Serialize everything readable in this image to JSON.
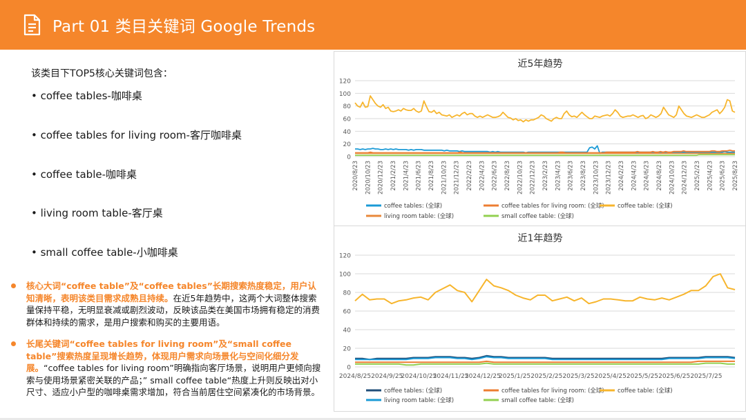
{
  "header": {
    "title": "Part 01 类目关键词 Google Trends",
    "icon": "document-icon",
    "bg_color": "#f5862b"
  },
  "left": {
    "intro": "该类目下TOP5核心关键词包含：",
    "keywords": [
      "• coffee tables-咖啡桌",
      "• coffee tables for living room-客厅咖啡桌",
      "• coffee table-咖啡桌",
      "• living room table-客厅桌",
      "• small coffee table-小咖啡桌"
    ],
    "notes": [
      {
        "highlight": "核心大词“coffee table”及“coffee tables”长期搜索热度稳定，用户认知清晰，表明该类目需求成熟且持续。",
        "body": "在近5年趋势中，这两个大词整体搜索量保持平稳，无明显衰减或剧烈波动，反映该品类在美国市场拥有稳定的消费群体和持续的需求，是用户搜索和购买的主要用语。"
      },
      {
        "highlight": "长尾关键词“coffee tables for living room”及“small coffee table”搜索热度呈现增长趋势，体现用户需求向场景化与空间化细分发展。",
        "body": "“coffee tables for living room”明确指向客厅场景，说明用户更倾向搜索与使用场景紧密关联的产品；” small coffee table“热度上升则反映出对小尺寸、适应小户型的咖啡桌需求增加，符合当前居住空间紧凑化的市场背景。"
      }
    ],
    "accent_color": "#f5862b"
  },
  "chart_data": [
    {
      "type": "line",
      "title": "近5年趋势",
      "ylim": [
        0,
        120
      ],
      "yticks": [
        0,
        20,
        40,
        60,
        80,
        100,
        120
      ],
      "grid": true,
      "legend_position": "bottom",
      "x_labels": [
        "2020/8/23",
        "2020/10/23",
        "2020/12/23",
        "2021/2/23",
        "2021/4/23",
        "2021/6/23",
        "2021/8/23",
        "2021/10/23",
        "2021/12/23",
        "2022/2/23",
        "2022/4/23",
        "2022/6/23",
        "2022/8/23",
        "2022/10/23",
        "2022/12/23",
        "2023/2/23",
        "2023/4/23",
        "2023/6/23",
        "2023/8/23",
        "2023/10/23",
        "2023/12/23",
        "2024/2/23",
        "2024/4/23",
        "2024/6/23",
        "2024/8/23",
        "2024/10/23",
        "2024/12/23",
        "2025/2/23",
        "2025/4/23",
        "2025/6/23",
        "2025/8/23"
      ],
      "legend_order": [
        "coffee tables: (全球)",
        "coffee tables for living room: (全球)",
        "coffee table: (全球)",
        "living room table: (全球)",
        "small coffee table: (全球)"
      ],
      "series": [
        {
          "name": "coffee table: (全球)",
          "color": "#f7b52c",
          "values": [
            85,
            80,
            78,
            86,
            78,
            79,
            96,
            90,
            84,
            80,
            78,
            82,
            76,
            78,
            72,
            71,
            72,
            74,
            72,
            76,
            74,
            73,
            73,
            76,
            72,
            70,
            72,
            88,
            79,
            71,
            70,
            73,
            68,
            70,
            66,
            65,
            64,
            66,
            62,
            64,
            66,
            64,
            68,
            70,
            66,
            68,
            68,
            64,
            62,
            64,
            62,
            64,
            66,
            64,
            62,
            62,
            63,
            65,
            70,
            66,
            62,
            61,
            58,
            60,
            57,
            58,
            55,
            58,
            56,
            58,
            58,
            60,
            62,
            66,
            64,
            60,
            58,
            56,
            60,
            62,
            60,
            60,
            68,
            72,
            66,
            63,
            64,
            62,
            66,
            70,
            66,
            63,
            60,
            60,
            64,
            63,
            62,
            64,
            65,
            66,
            64,
            68,
            74,
            70,
            64,
            62,
            63,
            64,
            64,
            66,
            64,
            62,
            64,
            65,
            60,
            62,
            66,
            64,
            62,
            64,
            68,
            78,
            72,
            66,
            64,
            62,
            66,
            80,
            74,
            68,
            64,
            63,
            62,
            64,
            66,
            64,
            62,
            62,
            64,
            66,
            70,
            72,
            74,
            68,
            72,
            78,
            90,
            88,
            72,
            70
          ]
        },
        {
          "name": "coffee tables: (全球)",
          "color": "#1a9ad6",
          "values": [
            12,
            12,
            11,
            12,
            11,
            12,
            12,
            13,
            12,
            12,
            11,
            11,
            12,
            11,
            12,
            11,
            12,
            11,
            11,
            11,
            11,
            10,
            11,
            10,
            11,
            11,
            11,
            10,
            10,
            10,
            10,
            10,
            10,
            10,
            10,
            9,
            10,
            9,
            9,
            9,
            9,
            8,
            9,
            8,
            8,
            8,
            8,
            8,
            8,
            8,
            8,
            8,
            8,
            7,
            8,
            7,
            8,
            7,
            7,
            7,
            7,
            7,
            7,
            7,
            7,
            7,
            7,
            6,
            7,
            7,
            7,
            7,
            7,
            7,
            7,
            7,
            7,
            7,
            7,
            7,
            7,
            7,
            7,
            7,
            7,
            7,
            7,
            7,
            7,
            7,
            7,
            7,
            14,
            15,
            12,
            17,
            5,
            7,
            7,
            7,
            7,
            7,
            7,
            7,
            7,
            7,
            7,
            7,
            7,
            7,
            7,
            7,
            7,
            7,
            7,
            7,
            7,
            7,
            7,
            7,
            7,
            7,
            7,
            7,
            7,
            7,
            7,
            7,
            7,
            7,
            7,
            7,
            7,
            7,
            7,
            7,
            7,
            7,
            7,
            7,
            7,
            7,
            7,
            7,
            7,
            8,
            7,
            7,
            7,
            7
          ]
        },
        {
          "name": "coffee tables for living room: (全球)",
          "color": "#ed7d31",
          "values": [
            6,
            6,
            6,
            6,
            6,
            6,
            7,
            6,
            6,
            6,
            6,
            6,
            6,
            6,
            6,
            6,
            6,
            6,
            6,
            6,
            6,
            6,
            6,
            6,
            6,
            6,
            6,
            6,
            6,
            6,
            6,
            6,
            6,
            6,
            6,
            6,
            6,
            6,
            6,
            6,
            6,
            7,
            6,
            6,
            6,
            6,
            6,
            6,
            6,
            6,
            6,
            6,
            6,
            6,
            6,
            6,
            6,
            6,
            6,
            6,
            6,
            6,
            6,
            6,
            6,
            6,
            6,
            6,
            6,
            6,
            6,
            6,
            6,
            6,
            6,
            6,
            6,
            6,
            6,
            6,
            7,
            7,
            6,
            6,
            6,
            6,
            6,
            6,
            6,
            6,
            6,
            6,
            6,
            6,
            6,
            6,
            6,
            6,
            7,
            7,
            7,
            7,
            7,
            7,
            7,
            7,
            7,
            7,
            7,
            7,
            8,
            7,
            7,
            7,
            7,
            7,
            8,
            7,
            7,
            8,
            7,
            8,
            7,
            7,
            8,
            8,
            8,
            8,
            9,
            8,
            8,
            8,
            8,
            8,
            8,
            8,
            8,
            8,
            8,
            9,
            9,
            8,
            8,
            9,
            9,
            9,
            10,
            9,
            9
          ]
        },
        {
          "name": "living room table: (全球)",
          "color": "#e8883a",
          "values": [
            5,
            5,
            5,
            5,
            5,
            5,
            5,
            5,
            5,
            5,
            5,
            5,
            5,
            5,
            5,
            5,
            5,
            5,
            5,
            5,
            5,
            5,
            5,
            5,
            5,
            5,
            5,
            5,
            5,
            5,
            5,
            5,
            5,
            5,
            5,
            5,
            5,
            5,
            5,
            5,
            5,
            5,
            5,
            5,
            5,
            5,
            5,
            5,
            5,
            5,
            5,
            5,
            5,
            5,
            5,
            5,
            5,
            5,
            5,
            5,
            5,
            5,
            5,
            5,
            5,
            5,
            5,
            5,
            5,
            5,
            5,
            5,
            5,
            5,
            5,
            5,
            5,
            5,
            5,
            5,
            5,
            5,
            5,
            5,
            5,
            5,
            5,
            5,
            5,
            5,
            5,
            5,
            5,
            5,
            5,
            5,
            5,
            5,
            5,
            5,
            5,
            5,
            5,
            5,
            5,
            5,
            5,
            5,
            5,
            5,
            5,
            5,
            5,
            5,
            5,
            5,
            5,
            5,
            5,
            5,
            5,
            5,
            5,
            5,
            5,
            5,
            5,
            5,
            5,
            5,
            5,
            5,
            5,
            5,
            5,
            5,
            5,
            5,
            5,
            5,
            5,
            5,
            5,
            5,
            5,
            5,
            5,
            5,
            5
          ]
        },
        {
          "name": "small coffee table: (全球)",
          "color": "#92d050",
          "values": [
            2,
            2,
            2,
            2,
            2,
            2,
            2,
            2,
            2,
            2,
            2,
            2,
            2,
            2,
            2,
            2,
            2,
            2,
            2,
            2,
            2,
            2,
            2,
            2,
            2,
            2,
            2,
            2,
            2,
            2,
            2,
            2,
            2,
            2,
            2,
            2,
            2,
            2,
            2,
            2,
            2,
            2,
            2,
            2,
            2,
            2,
            2,
            2,
            2,
            2,
            2,
            2,
            2,
            2,
            2,
            2,
            2,
            2,
            2,
            2,
            2,
            2,
            2,
            2,
            2,
            2,
            2,
            2,
            2,
            2,
            2,
            2,
            2,
            2,
            2,
            2,
            2,
            2,
            2,
            2,
            2,
            2,
            2,
            2,
            2,
            2,
            2,
            2,
            2,
            2,
            2,
            2,
            2,
            2,
            2,
            2,
            2,
            2,
            2,
            2,
            2,
            2,
            2,
            2,
            2,
            2,
            2,
            2,
            2,
            2,
            2,
            2,
            2,
            2,
            2,
            2,
            2,
            2,
            2,
            2,
            2,
            2,
            2,
            2,
            2,
            2,
            2,
            2,
            2,
            2,
            2,
            2,
            2,
            2,
            3,
            3,
            3,
            3,
            3,
            3,
            3,
            3,
            3,
            3,
            3,
            3,
            3,
            3,
            3
          ]
        }
      ]
    },
    {
      "type": "line",
      "title": "近1年趋势",
      "ylim": [
        0,
        120
      ],
      "yticks": [
        0,
        20,
        40,
        60,
        80,
        100,
        120
      ],
      "grid": true,
      "legend_position": "bottom",
      "x_labels": [
        "2024/8/25",
        "2024/9/25",
        "2024/10/25",
        "2024/11/25",
        "2024/12/25",
        "2025/1/25",
        "2025/2/25",
        "2025/3/25",
        "2025/4/25",
        "2025/5/25",
        "2025/6/25",
        "2025/7/25"
      ],
      "legend_order": [
        "coffee tables: (全球)",
        "coffee tables for living room: (全球)",
        "coffee table: (全球)",
        "living room table: (全球)",
        "small coffee table: (全球)"
      ],
      "series": [
        {
          "name": "coffee table: (全球)",
          "color": "#f7b52c",
          "values": [
            71,
            78,
            72,
            73,
            73,
            68,
            71,
            72,
            74,
            75,
            72,
            80,
            84,
            88,
            82,
            80,
            70,
            82,
            94,
            87,
            85,
            82,
            77,
            74,
            72,
            77,
            77,
            71,
            73,
            75,
            71,
            74,
            68,
            70,
            73,
            73,
            72,
            71,
            71,
            75,
            73,
            72,
            74,
            72,
            75,
            78,
            82,
            82,
            87,
            97,
            100,
            85,
            83
          ]
        },
        {
          "name": "coffee tables: (全球)",
          "color": "#1f4e79",
          "values": [
            9,
            9,
            8,
            9,
            9,
            9,
            9,
            9,
            10,
            10,
            10,
            11,
            11,
            11,
            10,
            10,
            9,
            10,
            12,
            11,
            11,
            10,
            10,
            10,
            10,
            10,
            10,
            9,
            9,
            9,
            9,
            9,
            9,
            9,
            9,
            9,
            9,
            9,
            9,
            9,
            9,
            9,
            9,
            10,
            10,
            10,
            10,
            10,
            11,
            11,
            11,
            11,
            10
          ]
        },
        {
          "name": "living room table: (全球)",
          "color": "#1a9ad6",
          "values": [
            8,
            8,
            8,
            8,
            8,
            8,
            8,
            8,
            9,
            9,
            9,
            10,
            10,
            10,
            9,
            9,
            8,
            9,
            11,
            10,
            10,
            9,
            9,
            9,
            9,
            9,
            9,
            8,
            8,
            8,
            8,
            8,
            8,
            8,
            8,
            8,
            8,
            8,
            8,
            8,
            8,
            8,
            8,
            9,
            9,
            9,
            9,
            9,
            10,
            10,
            10,
            10,
            9
          ]
        },
        {
          "name": "coffee tables for living room: (全球)",
          "color": "#ed7d31",
          "values": [
            5,
            5,
            5,
            5,
            5,
            5,
            5,
            5,
            5,
            5,
            5,
            5,
            5,
            5,
            5,
            5,
            5,
            5,
            6,
            5,
            5,
            5,
            5,
            5,
            5,
            5,
            5,
            5,
            5,
            5,
            5,
            5,
            5,
            5,
            5,
            5,
            5,
            5,
            5,
            5,
            5,
            5,
            5,
            5,
            5,
            5,
            5,
            6,
            6,
            6,
            6,
            6,
            6
          ]
        },
        {
          "name": "small coffee table: (全球)",
          "color": "#92d050",
          "values": [
            3,
            3,
            3,
            3,
            3,
            3,
            3,
            2,
            2,
            3,
            3,
            3,
            3,
            3,
            3,
            3,
            3,
            3,
            4,
            3,
            3,
            3,
            3,
            3,
            3,
            3,
            3,
            3,
            3,
            3,
            3,
            3,
            3,
            3,
            3,
            3,
            3,
            3,
            3,
            3,
            3,
            3,
            3,
            3,
            3,
            3,
            3,
            3,
            4,
            4,
            4,
            3,
            3
          ]
        }
      ]
    }
  ]
}
